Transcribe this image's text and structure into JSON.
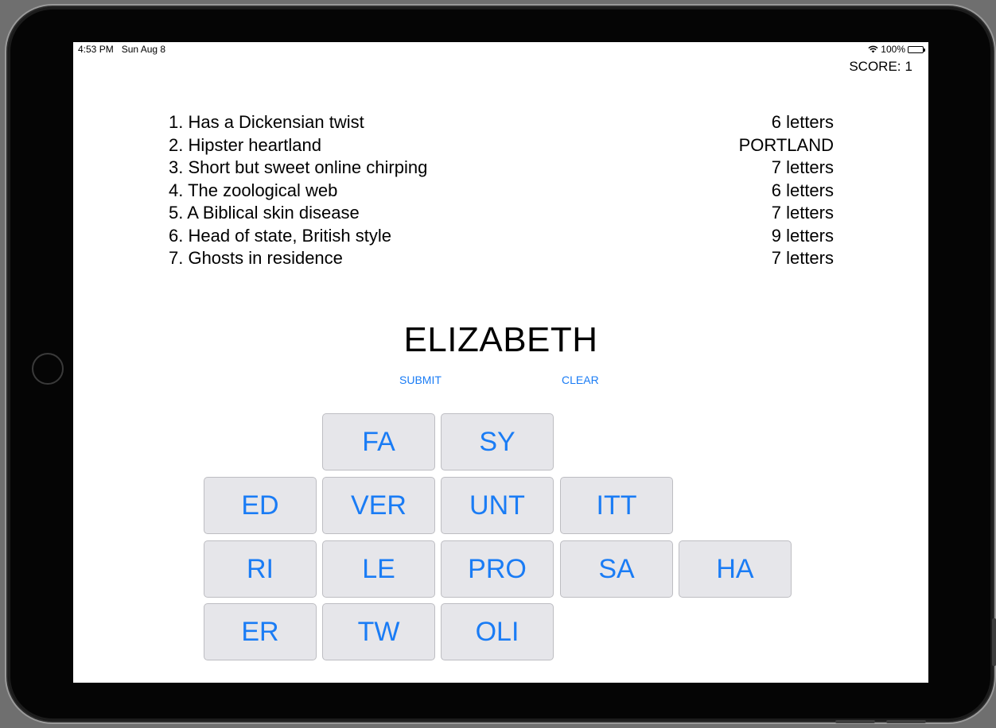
{
  "status_bar": {
    "time": "4:53 PM",
    "date": "Sun Aug 8",
    "battery": "100%",
    "wifi_icon": "wifi-icon"
  },
  "score": {
    "label": "SCORE:",
    "value": "1"
  },
  "clues": [
    {
      "text": "1. Has a Dickensian twist",
      "hint": "6 letters"
    },
    {
      "text": "2. Hipster heartland",
      "hint": "PORTLAND"
    },
    {
      "text": "3. Short but sweet online chirping",
      "hint": "7 letters"
    },
    {
      "text": "4. The zoological web",
      "hint": "6 letters"
    },
    {
      "text": "5. A Biblical skin disease",
      "hint": "7 letters"
    },
    {
      "text": "6. Head of state, British style",
      "hint": "9 letters"
    },
    {
      "text": "7. Ghosts in residence",
      "hint": "7 letters"
    }
  ],
  "current_answer": "ELIZABETH",
  "actions": {
    "submit": "SUBMIT",
    "clear": "CLEAR"
  },
  "tiles": [
    [
      "FA",
      "SY"
    ],
    [
      "ED",
      "VER",
      "UNT",
      "ITT"
    ],
    [
      "RI",
      "LE",
      "PRO",
      "SA",
      "HA"
    ],
    [
      "ER",
      "TW",
      "OLI"
    ]
  ],
  "colors": {
    "accent": "#1a7cf5",
    "tile_bg": "#e6e6ea",
    "tile_border": "#bdbdc2"
  }
}
